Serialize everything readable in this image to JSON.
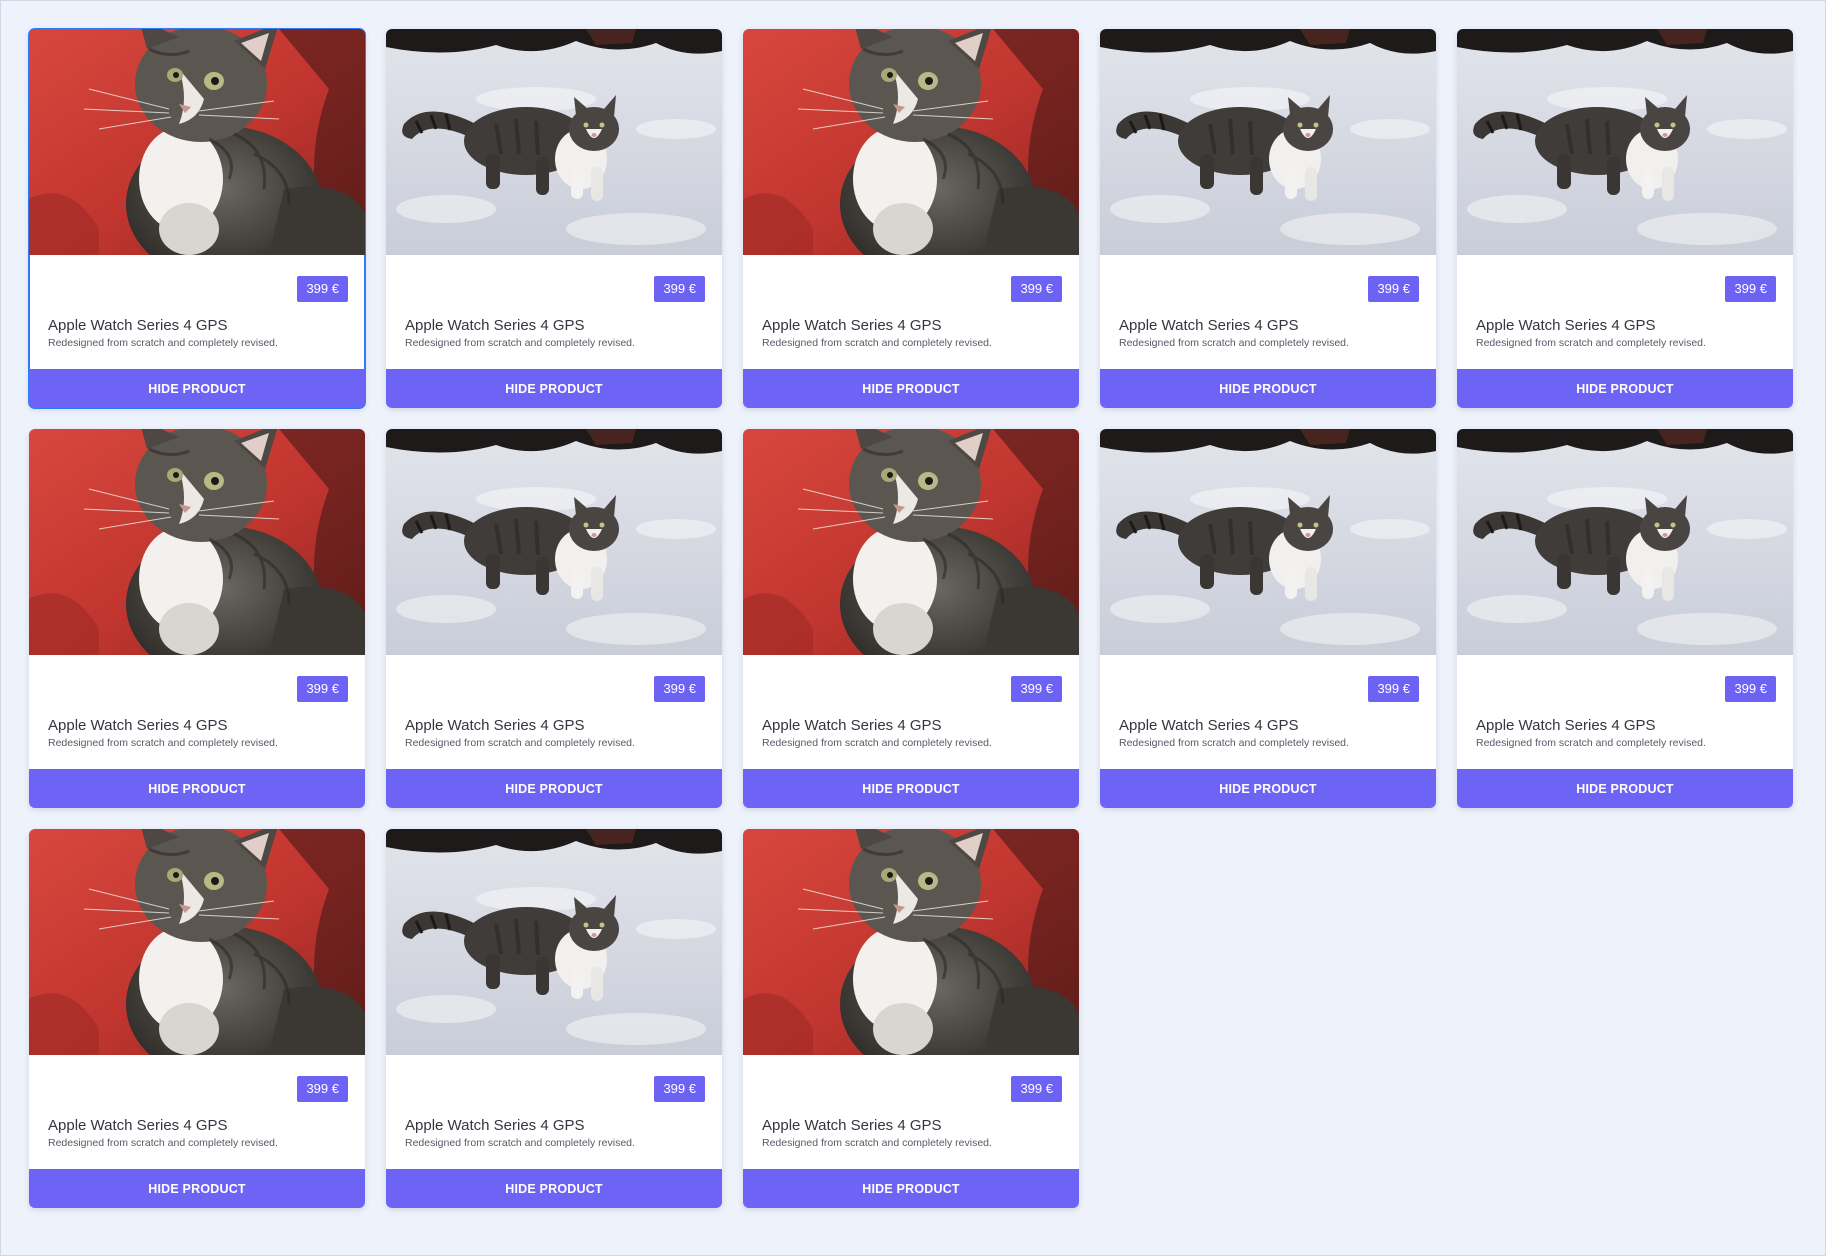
{
  "products": [
    {
      "image": "kitten-red-background",
      "price": "399 €",
      "title": "Apple Watch Series 4 GPS",
      "description": "Redesigned from scratch and completely revised.",
      "button_label": "HIDE PRODUCT",
      "selected": true
    },
    {
      "image": "cat-in-snow",
      "price": "399 €",
      "title": "Apple Watch Series 4 GPS",
      "description": "Redesigned from scratch and completely revised.",
      "button_label": "HIDE PRODUCT",
      "selected": false
    },
    {
      "image": "kitten-red-background",
      "price": "399 €",
      "title": "Apple Watch Series 4 GPS",
      "description": "Redesigned from scratch and completely revised.",
      "button_label": "HIDE PRODUCT",
      "selected": false
    },
    {
      "image": "cat-in-snow",
      "price": "399 €",
      "title": "Apple Watch Series 4 GPS",
      "description": "Redesigned from scratch and completely revised.",
      "button_label": "HIDE PRODUCT",
      "selected": false
    },
    {
      "image": "cat-in-snow",
      "price": "399 €",
      "title": "Apple Watch Series 4 GPS",
      "description": "Redesigned from scratch and completely revised.",
      "button_label": "HIDE PRODUCT",
      "selected": false
    },
    {
      "image": "kitten-red-background",
      "price": "399 €",
      "title": "Apple Watch Series 4 GPS",
      "description": "Redesigned from scratch and completely revised.",
      "button_label": "HIDE PRODUCT",
      "selected": false
    },
    {
      "image": "cat-in-snow",
      "price": "399 €",
      "title": "Apple Watch Series 4 GPS",
      "description": "Redesigned from scratch and completely revised.",
      "button_label": "HIDE PRODUCT",
      "selected": false
    },
    {
      "image": "kitten-red-background",
      "price": "399 €",
      "title": "Apple Watch Series 4 GPS",
      "description": "Redesigned from scratch and completely revised.",
      "button_label": "HIDE PRODUCT",
      "selected": false
    },
    {
      "image": "cat-in-snow",
      "price": "399 €",
      "title": "Apple Watch Series 4 GPS",
      "description": "Redesigned from scratch and completely revised.",
      "button_label": "HIDE PRODUCT",
      "selected": false
    },
    {
      "image": "cat-in-snow",
      "price": "399 €",
      "title": "Apple Watch Series 4 GPS",
      "description": "Redesigned from scratch and completely revised.",
      "button_label": "HIDE PRODUCT",
      "selected": false
    },
    {
      "image": "kitten-red-background",
      "price": "399 €",
      "title": "Apple Watch Series 4 GPS",
      "description": "Redesigned from scratch and completely revised.",
      "button_label": "HIDE PRODUCT",
      "selected": false
    },
    {
      "image": "cat-in-snow",
      "price": "399 €",
      "title": "Apple Watch Series 4 GPS",
      "description": "Redesigned from scratch and completely revised.",
      "button_label": "HIDE PRODUCT",
      "selected": false
    },
    {
      "image": "kitten-red-background",
      "price": "399 €",
      "title": "Apple Watch Series 4 GPS",
      "description": "Redesigned from scratch and completely revised.",
      "button_label": "HIDE PRODUCT",
      "selected": false
    }
  ],
  "colors": {
    "page_background": "#edf2fb",
    "accent": "#6c63f5",
    "selection_outline": "#2f7bf5"
  }
}
